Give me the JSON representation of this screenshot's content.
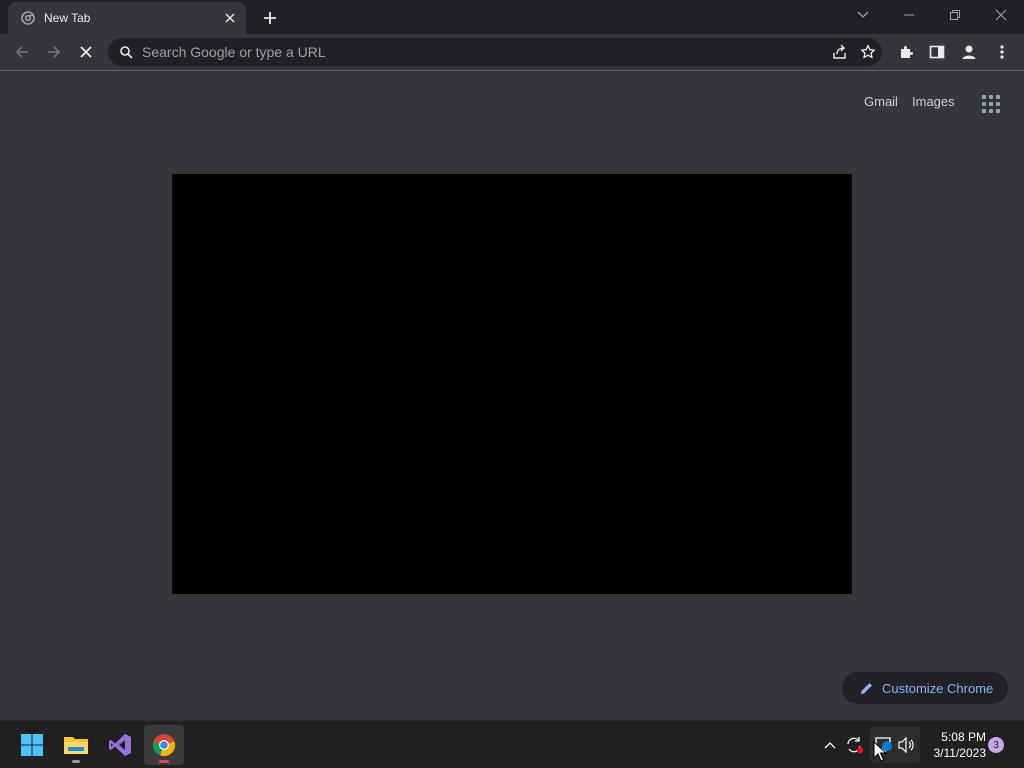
{
  "tab": {
    "title": "New Tab",
    "favicon": "chrome-icon"
  },
  "window_controls": [
    "tab-search-icon",
    "minimize-icon",
    "restore-icon",
    "close-icon"
  ],
  "toolbar": {
    "back_icon": "arrow-left-icon",
    "forward_icon": "arrow-right-icon",
    "stop_icon": "stop-loading-icon",
    "omnibox_placeholder": "Search Google or type a URL",
    "share_icon": "share-icon",
    "bookmark_icon": "star-icon",
    "extensions_icon": "puzzle-icon",
    "side_panel_icon": "side-panel-icon",
    "profile_icon": "profile-icon",
    "menu_icon": "kebab-menu-icon"
  },
  "ntp": {
    "links": [
      "Gmail",
      "Images"
    ],
    "apps_icon": "apps-grid-icon",
    "customize_label": "Customize Chrome"
  },
  "taskbar": {
    "apps": [
      "windows-start",
      "file-explorer",
      "visual-studio",
      "google-chrome"
    ],
    "active_app": "google-chrome",
    "tray": [
      "chevron-up-icon",
      "sync-icon",
      "network-icon",
      "volume-icon"
    ],
    "time": "5:08 PM",
    "date": "3/11/2023",
    "notification_count": "3"
  },
  "colors": {
    "accent": "#8ab4f8",
    "frame": "#202124",
    "toolbar": "#35363a",
    "taskbar": "#202020"
  }
}
